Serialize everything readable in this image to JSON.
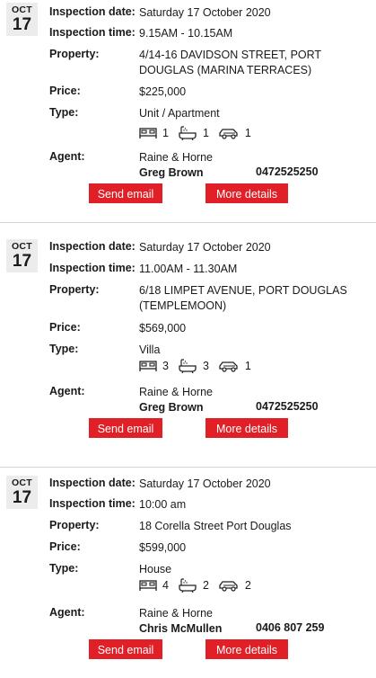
{
  "labels": {
    "date": "Inspection date:",
    "time": "Inspection time:",
    "property": "Property:",
    "price": "Price:",
    "type": "Type:",
    "agent": "Agent:",
    "send_email": "Send email",
    "more_details": "More details"
  },
  "icons": [
    "bed-icon",
    "bath-icon",
    "car-icon"
  ],
  "colors": {
    "button": "#e01f26",
    "badge": "#ececec"
  },
  "listings": [
    {
      "month": "OCT",
      "day": "17",
      "date": "Saturday 17 October 2020",
      "time": "9.15AM - 10.15AM",
      "property": "4/14-16 DAVIDSON STREET, PORT DOUGLAS (MARINA TERRACES)",
      "price": "$225,000",
      "type": "Unit / Apartment",
      "beds": "1",
      "baths": "1",
      "cars": "1",
      "agency": "Raine & Horne",
      "agent_name": "Greg Brown",
      "agent_phone": "0472525250"
    },
    {
      "month": "OCT",
      "day": "17",
      "date": "Saturday 17 October 2020",
      "time": "11.00AM - 11.30AM",
      "property": "6/18 LIMPET AVENUE, PORT DOUGLAS (TEMPLEMOON)",
      "price": "$569,000",
      "type": "Villa",
      "beds": "3",
      "baths": "3",
      "cars": "1",
      "agency": "Raine & Horne",
      "agent_name": "Greg Brown",
      "agent_phone": "0472525250"
    },
    {
      "month": "OCT",
      "day": "17",
      "date": "Saturday 17 October 2020",
      "time": "10:00 am",
      "property": "18 Corella Street Port Douglas",
      "price": "$599,000",
      "type": "House",
      "beds": "4",
      "baths": "2",
      "cars": "2",
      "agency": "Raine & Horne",
      "agent_name": "Chris McMullen",
      "agent_phone": "0406 807 259"
    }
  ]
}
